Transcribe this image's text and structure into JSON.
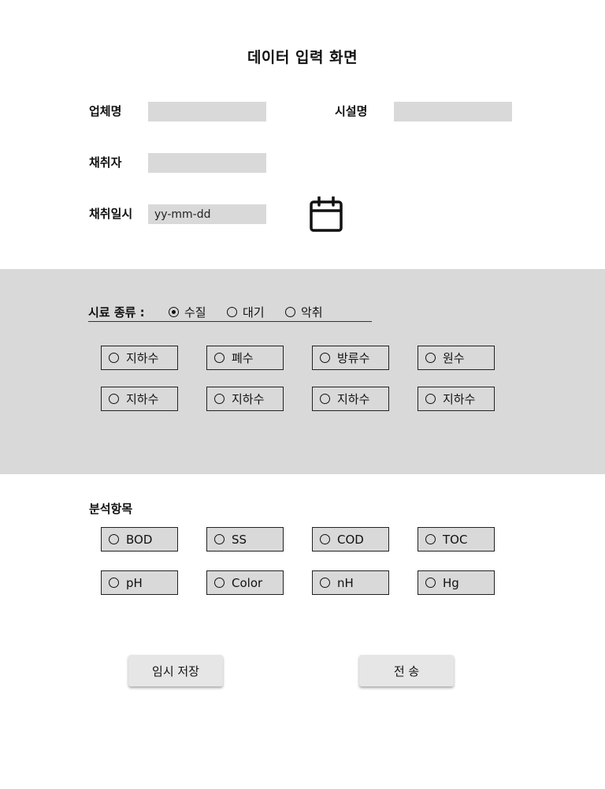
{
  "page": {
    "title": "데이터 입력 화면"
  },
  "form": {
    "company_label": "업체명",
    "company_value": "",
    "facility_label": "시설명",
    "facility_value": "",
    "sampler_label": "채취자",
    "sampler_value": "",
    "sample_date_label": "채취일시",
    "sample_date_placeholder": "yy-mm-dd",
    "calendar_icon": "calendar-icon"
  },
  "sample_type": {
    "label": "시료 종류 :",
    "options": [
      {
        "label": "수질",
        "checked": true
      },
      {
        "label": "대기",
        "checked": false
      },
      {
        "label": "악취",
        "checked": false
      }
    ],
    "subtypes": [
      {
        "label": "지하수",
        "checked": false
      },
      {
        "label": "폐수",
        "checked": false
      },
      {
        "label": "방류수",
        "checked": false
      },
      {
        "label": "원수",
        "checked": false
      },
      {
        "label": "지하수",
        "checked": false
      },
      {
        "label": "지하수",
        "checked": false
      },
      {
        "label": "지하수",
        "checked": false
      },
      {
        "label": "지하수",
        "checked": false
      }
    ]
  },
  "analysis": {
    "label": "분석항목",
    "items": [
      {
        "label": "BOD",
        "checked": false
      },
      {
        "label": "SS",
        "checked": false
      },
      {
        "label": "COD",
        "checked": false
      },
      {
        "label": "TOC",
        "checked": false
      },
      {
        "label": "pH",
        "checked": false
      },
      {
        "label": "Color",
        "checked": false
      },
      {
        "label": "nH",
        "checked": false
      },
      {
        "label": "Hg",
        "checked": false
      }
    ]
  },
  "buttons": {
    "save_label": "임시 저장",
    "send_label": "전 송"
  },
  "colors": {
    "panel_gray": "#d9d9d9",
    "text": "#111111",
    "button_bg": "#e6e6e6"
  }
}
